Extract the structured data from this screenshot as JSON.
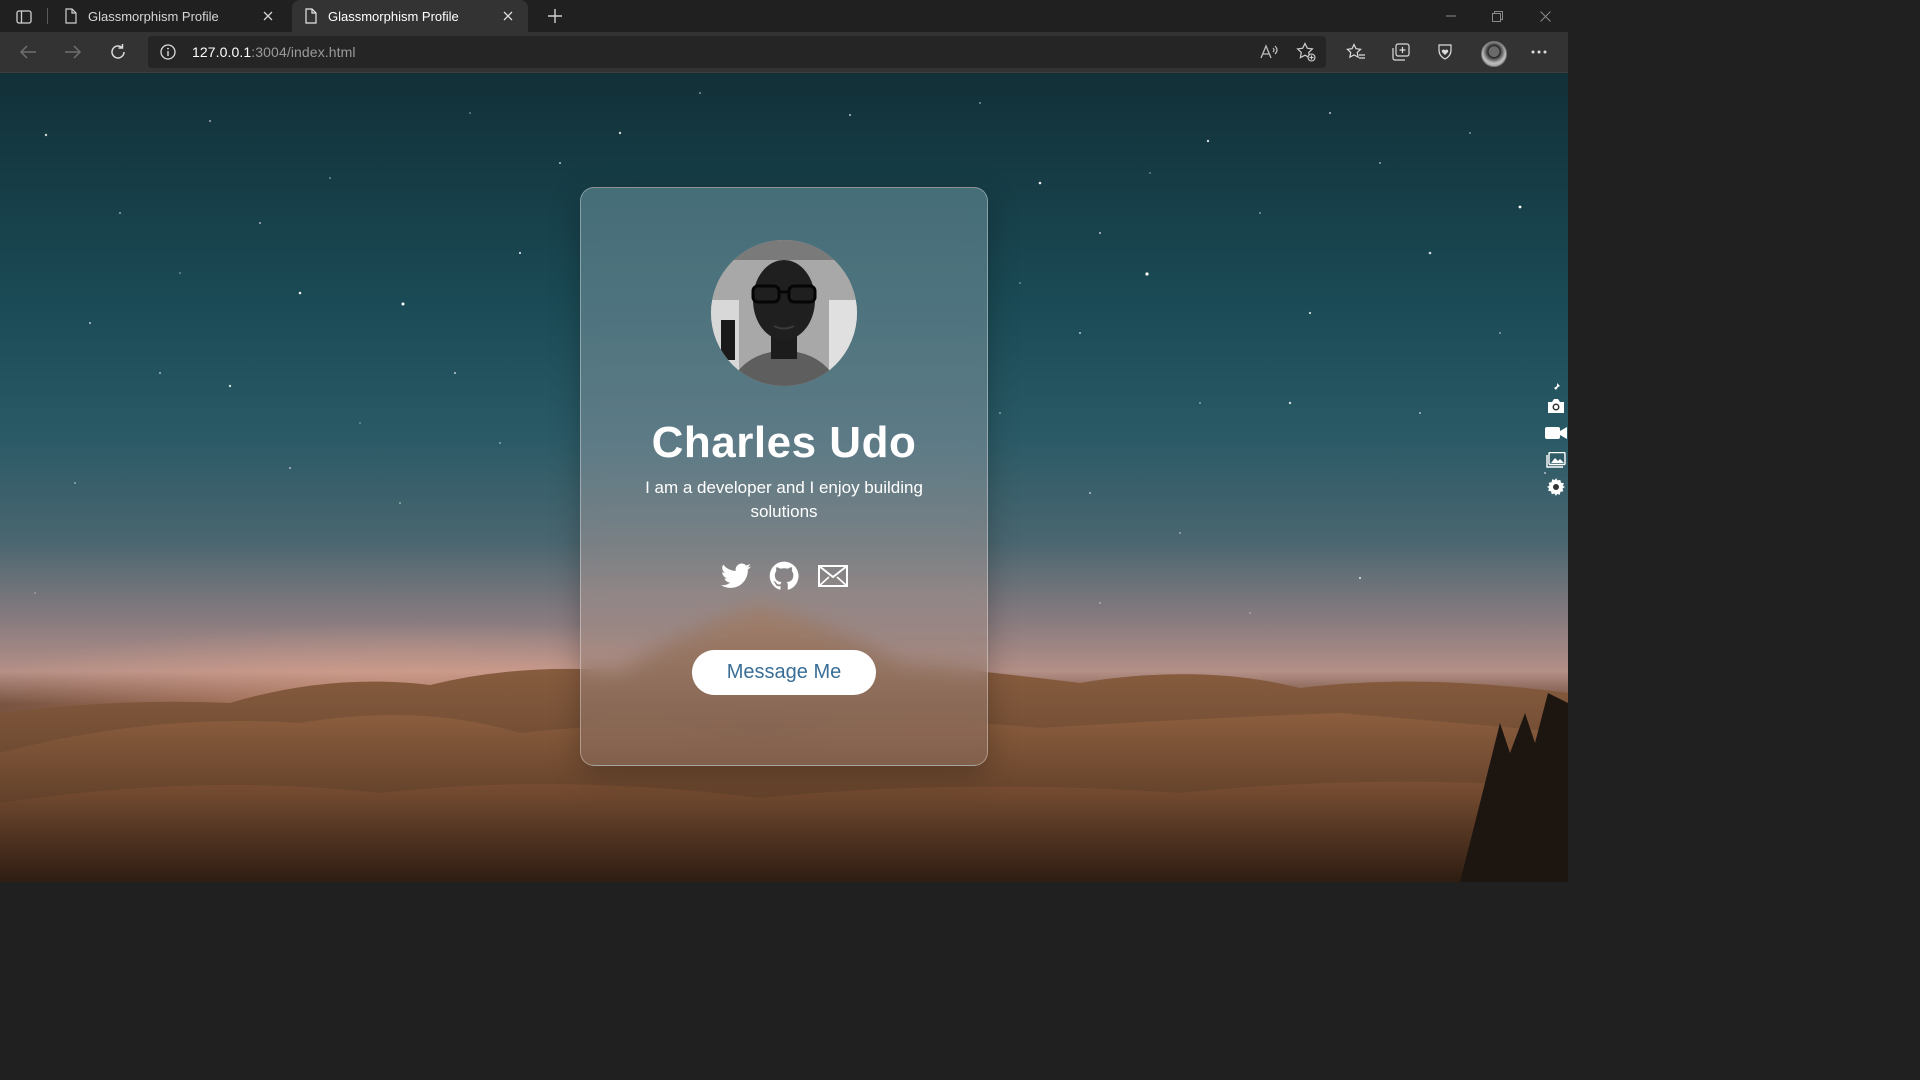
{
  "browser": {
    "tabs": [
      {
        "title": "Glassmorphism Profile",
        "active": false
      },
      {
        "title": "Glassmorphism Profile",
        "active": true
      }
    ],
    "url": {
      "host": "127.0.0.1",
      "rest": ":3004/index.html"
    }
  },
  "profile": {
    "name": "Charles Udo",
    "bio": "I am a developer and I enjoy building solutions",
    "social": [
      "twitter-icon",
      "github-icon",
      "mail-icon"
    ],
    "button_label": "Message Me"
  },
  "side_tools": [
    "pin-icon",
    "camera-icon",
    "video-icon",
    "gallery-icon",
    "settings-icon"
  ],
  "colors": {
    "button_text": "#3a6e96",
    "chrome_bg": "#202020",
    "toolbar_bg": "#333333"
  }
}
